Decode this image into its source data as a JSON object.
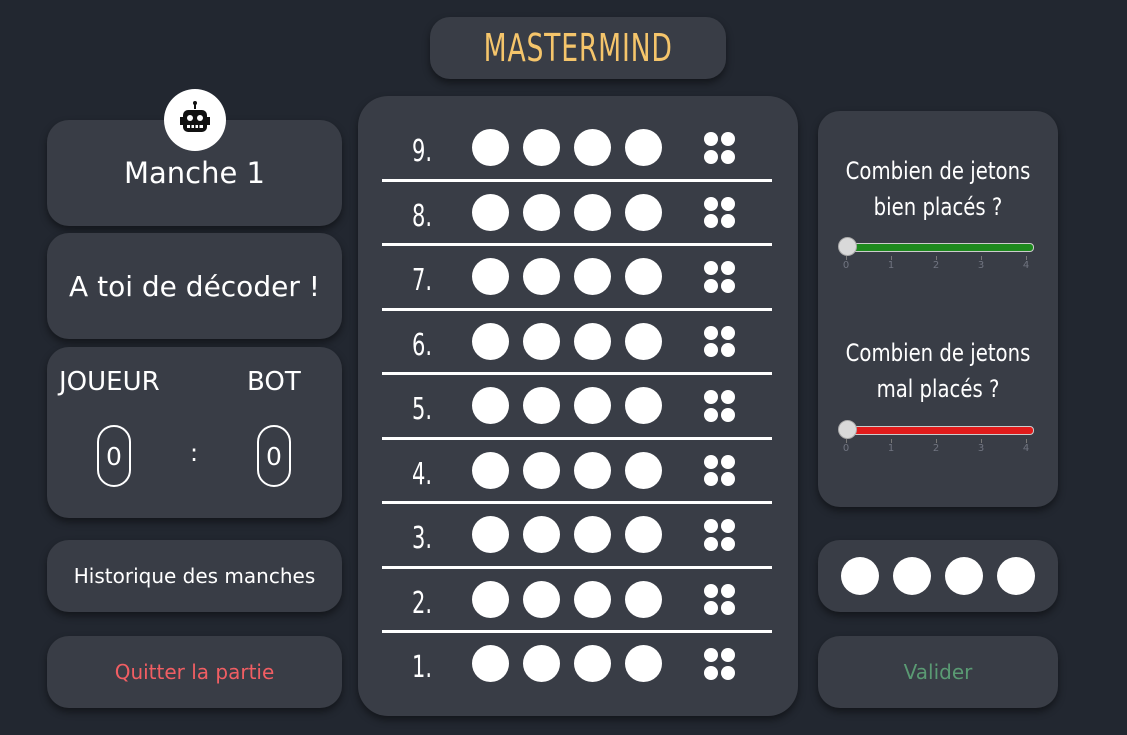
{
  "title": "MASTERMIND",
  "left": {
    "round_label": "Manche 1",
    "status_message": "A toi de décoder !",
    "score": {
      "player_label": "JOUEUR",
      "bot_label": "BOT",
      "player_score": "0",
      "separator": ":",
      "bot_score": "0"
    },
    "history_button": "Historique des manches",
    "quit_button": "Quitter la partie"
  },
  "board": {
    "rows": [
      {
        "num": "9."
      },
      {
        "num": "8."
      },
      {
        "num": "7."
      },
      {
        "num": "6."
      },
      {
        "num": "5."
      },
      {
        "num": "4."
      },
      {
        "num": "3."
      },
      {
        "num": "2."
      },
      {
        "num": "1."
      }
    ],
    "peg_color": "#ffffff"
  },
  "right": {
    "well_placed_question": "Combien de jetons bien placés ?",
    "misplaced_question": "Combien de jetons mal placés ?",
    "well_placed_value": 0,
    "misplaced_value": 0,
    "slider_ticks": [
      "0",
      "1",
      "2",
      "3",
      "4"
    ],
    "well_placed_color": "#1e8a1e",
    "misplaced_color": "#e11b1b",
    "validate_button": "Valider"
  },
  "icons": {
    "avatar": "robot-icon"
  },
  "colors": {
    "background": "#222730",
    "card": "#393d46",
    "title": "#f5c56b",
    "quit": "#f15e63",
    "validate": "#5a9a73"
  }
}
